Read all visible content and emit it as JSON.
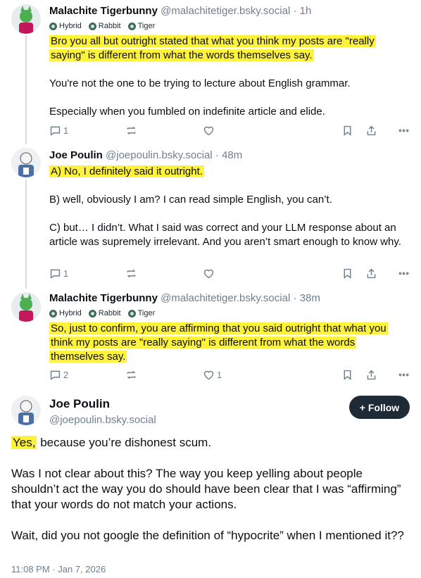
{
  "posts": [
    {
      "name": "Malachite Tigerbunny",
      "handle": "@malachitetiger.bsky.social",
      "time": "1h",
      "badges": [
        "Hybrid",
        "Rabbit",
        "Tiger"
      ],
      "paragraphs": [
        "Bro you all but outright stated that what you think my posts are \"really saying\" is different from what the words themselves say.",
        "You're not the one to be trying to lecture about English grammar.",
        "Especially when you fumbled on indefinite article and elide."
      ],
      "replies": "1",
      "reposts": "",
      "likes": ""
    },
    {
      "name": "Joe Poulin",
      "handle": "@joepoulin.bsky.social",
      "time": "48m",
      "paragraphs": [
        "A) No, I definitely said it outright.",
        "B) well, obviously I am? I can read simple English, you can’t.",
        "C) but… I didn’t. What I said was correct and your LLM response about an article was supremely irrelevant. And you aren’t smart enough to know why."
      ],
      "replies": "1",
      "reposts": "",
      "likes": ""
    },
    {
      "name": "Malachite Tigerbunny",
      "handle": "@malachitetiger.bsky.social",
      "time": "38m",
      "badges": [
        "Hybrid",
        "Rabbit",
        "Tiger"
      ],
      "paragraphs": [
        "So, just to confirm, you are affirming that you said outright that what you think my posts are \"really saying\" is different from what the words themselves say."
      ],
      "replies": "2",
      "reposts": "",
      "likes": "1"
    }
  ],
  "main_post": {
    "name": "Joe Poulin",
    "handle": "@joepoulin.bsky.social",
    "follow_label": "+ Follow",
    "highlight": "Yes,",
    "first_rest": " because you’re dishonest scum.",
    "paragraphs": [
      "Was I not clear about this? The way you keep yelling about people shouldn’t act the way you do should have been clear that I was “affirming” that your words do not match your actions.",
      "Wait, did you not google the definition of “hypocrite” when I mentioned it??"
    ],
    "timestamp": "11:08 PM · Jan 7, 2026"
  },
  "separator": "·",
  "colors": {
    "highlight": "#fff23a",
    "muted": "#6f7f8f",
    "follow_bg": "#1f2a37"
  },
  "icons": [
    "reply-icon",
    "repost-icon",
    "like-icon",
    "bookmark-icon",
    "share-icon",
    "more-icon",
    "tag-icon"
  ]
}
